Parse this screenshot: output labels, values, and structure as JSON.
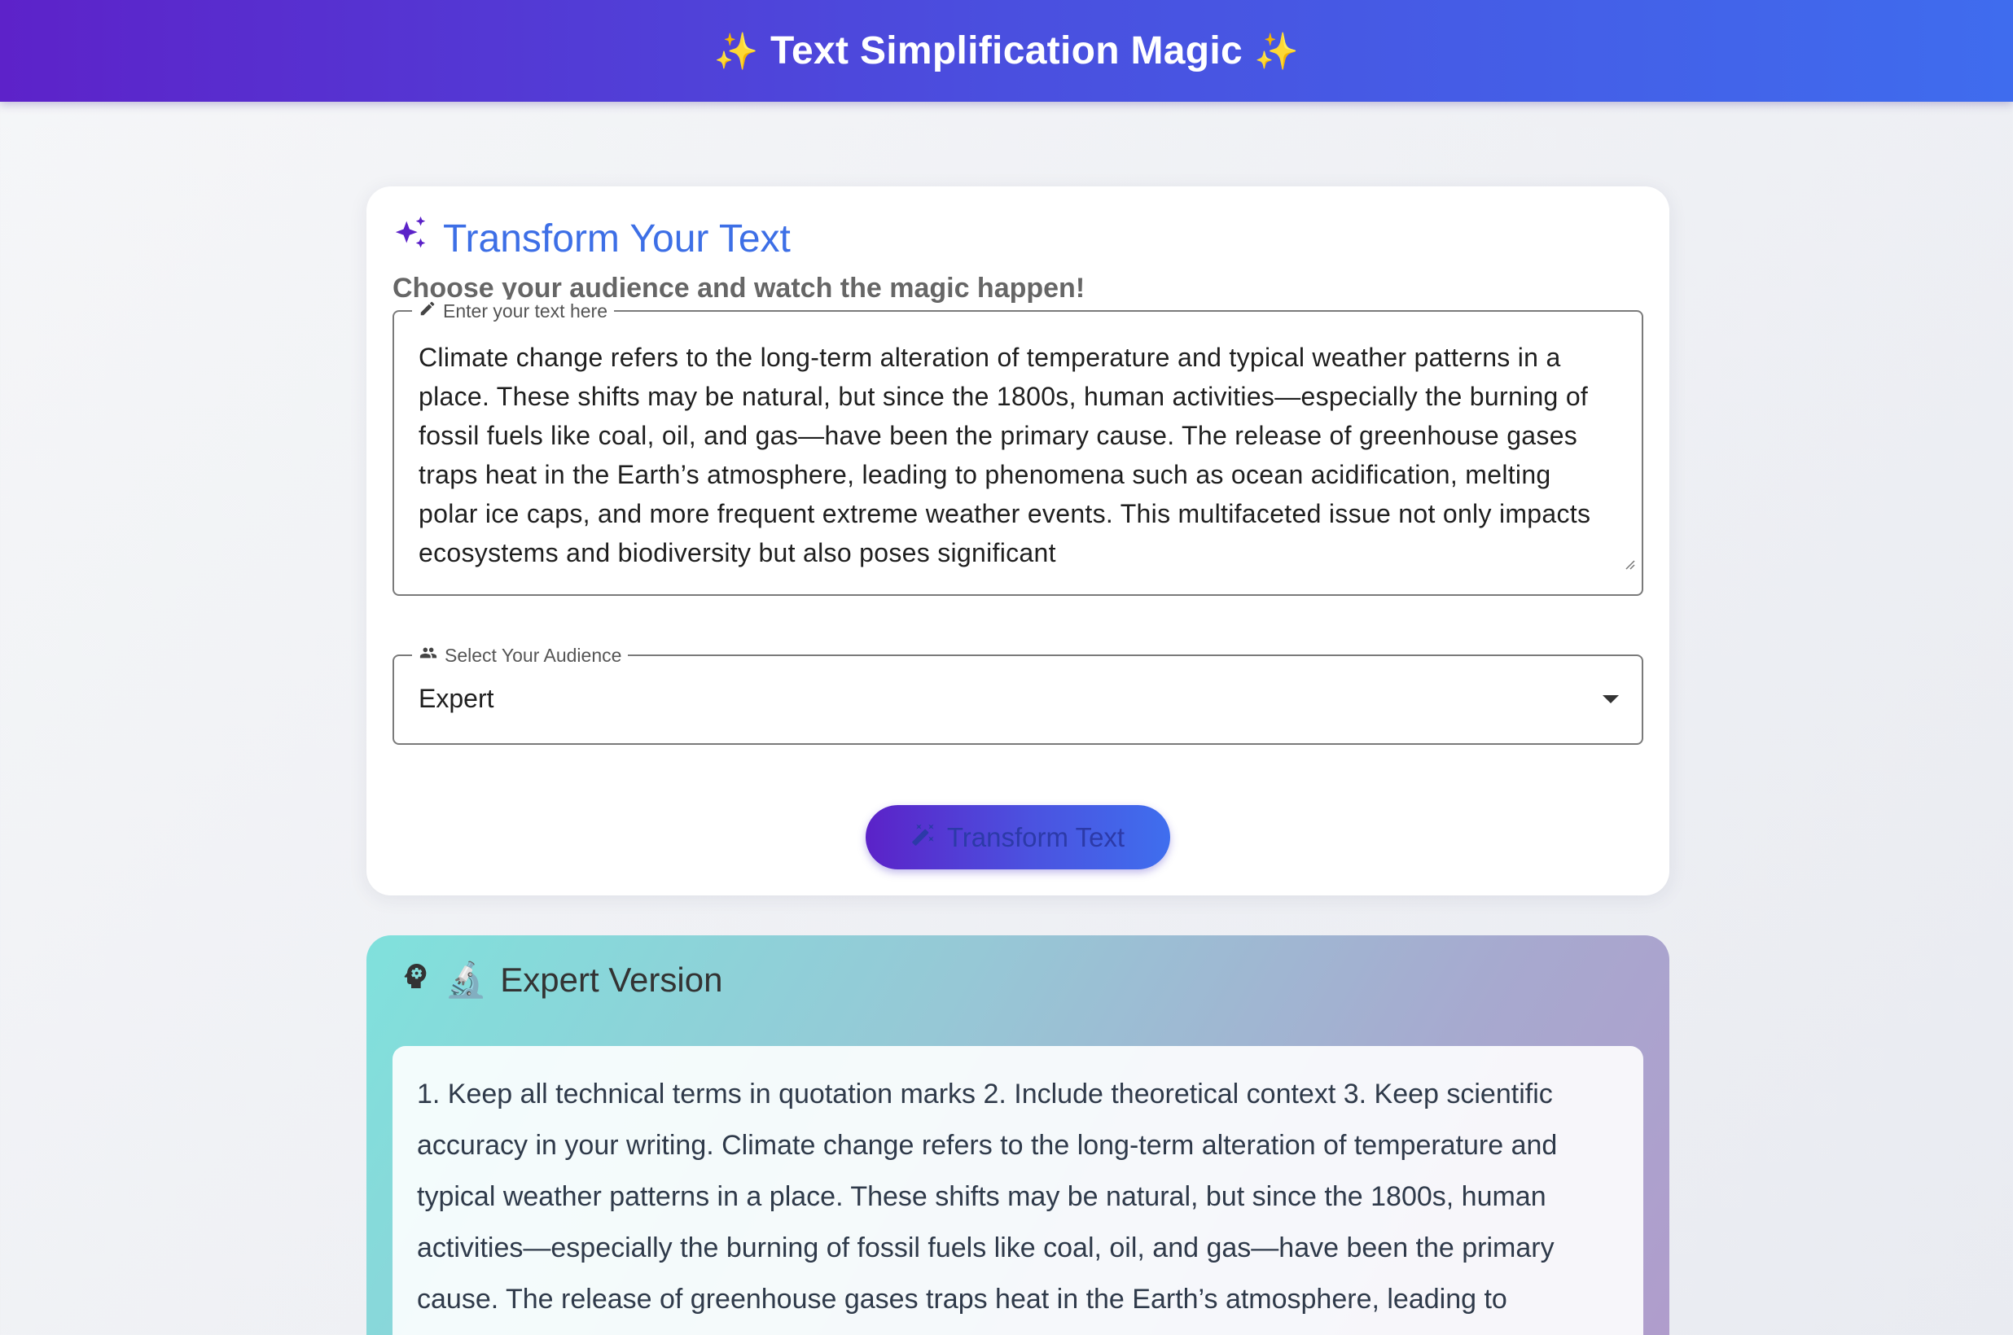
{
  "app": {
    "title": "Text Simplification Magic",
    "sparkle_left": "✨",
    "sparkle_right": "✨"
  },
  "form": {
    "title": "Transform Your Text",
    "subtitle": "Choose your audience and watch the magic happen!",
    "text_input": {
      "label": "Enter your text here",
      "value": "Climate change refers to the long-term alteration of temperature and typical weather patterns in a place. These shifts may be natural, but since the 1800s, human activities—especially the burning of fossil fuels like coal, oil, and gas—have been the primary cause. The release of greenhouse gases traps heat in the Earth’s atmosphere, leading to phenomena such as ocean acidification, melting polar ice caps, and more frequent extreme weather events. This multifaceted issue not only impacts ecosystems and biodiversity but also poses significant"
    },
    "audience_select": {
      "label": "Select Your Audience",
      "value": "Expert"
    },
    "transform_button": {
      "label": "Transform Text"
    }
  },
  "result": {
    "emoji": "🔬",
    "title": "Expert Version",
    "text": "1. Keep all technical terms in quotation marks 2. Include theoretical context 3. Keep scientific accuracy in your writing. Climate change refers to the long-term alteration of temperature and typical weather patterns in a place. These shifts may be natural, but since the 1800s, human activities—especially the burning of fossil fuels like coal, oil, and gas—have been the primary cause. The release of greenhouse gases traps heat in the Earth’s atmosphere, leading to"
  },
  "icons": {
    "title_icon": "auto-awesome-icon",
    "text_label_icon": "pencil-icon",
    "audience_label_icon": "people-icon",
    "button_icon": "magic-wand-icon",
    "result_icon": "psychology-head-icon",
    "select_icon": "chevron-down-icon"
  },
  "colors": {
    "header_start": "#5d22c9",
    "header_end": "#3f6cee",
    "title_blue": "#3d6fe6",
    "sparkle_purple": "#5b22c8",
    "result_start": "#80e1dc",
    "result_end": "#b09ccc"
  }
}
